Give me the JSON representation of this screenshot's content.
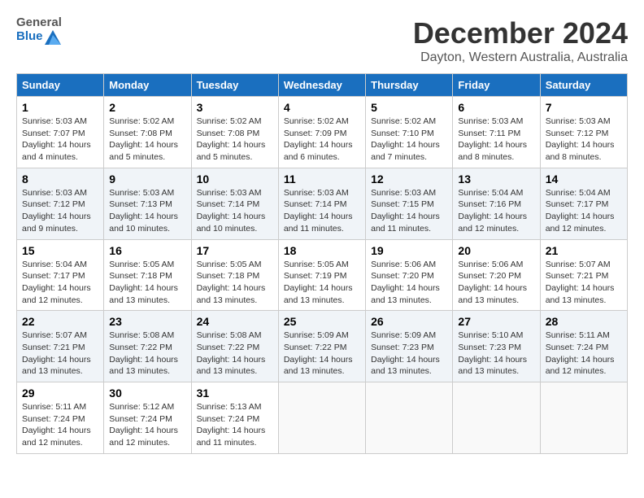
{
  "logo": {
    "general": "General",
    "blue": "Blue"
  },
  "title": "December 2024",
  "location": "Dayton, Western Australia, Australia",
  "headers": [
    "Sunday",
    "Monday",
    "Tuesday",
    "Wednesday",
    "Thursday",
    "Friday",
    "Saturday"
  ],
  "weeks": [
    [
      {
        "day": "1",
        "sunrise": "5:03 AM",
        "sunset": "7:07 PM",
        "daylight": "14 hours and 4 minutes."
      },
      {
        "day": "2",
        "sunrise": "5:02 AM",
        "sunset": "7:08 PM",
        "daylight": "14 hours and 5 minutes."
      },
      {
        "day": "3",
        "sunrise": "5:02 AM",
        "sunset": "7:08 PM",
        "daylight": "14 hours and 5 minutes."
      },
      {
        "day": "4",
        "sunrise": "5:02 AM",
        "sunset": "7:09 PM",
        "daylight": "14 hours and 6 minutes."
      },
      {
        "day": "5",
        "sunrise": "5:02 AM",
        "sunset": "7:10 PM",
        "daylight": "14 hours and 7 minutes."
      },
      {
        "day": "6",
        "sunrise": "5:03 AM",
        "sunset": "7:11 PM",
        "daylight": "14 hours and 8 minutes."
      },
      {
        "day": "7",
        "sunrise": "5:03 AM",
        "sunset": "7:12 PM",
        "daylight": "14 hours and 8 minutes."
      }
    ],
    [
      {
        "day": "8",
        "sunrise": "5:03 AM",
        "sunset": "7:12 PM",
        "daylight": "14 hours and 9 minutes."
      },
      {
        "day": "9",
        "sunrise": "5:03 AM",
        "sunset": "7:13 PM",
        "daylight": "14 hours and 10 minutes."
      },
      {
        "day": "10",
        "sunrise": "5:03 AM",
        "sunset": "7:14 PM",
        "daylight": "14 hours and 10 minutes."
      },
      {
        "day": "11",
        "sunrise": "5:03 AM",
        "sunset": "7:14 PM",
        "daylight": "14 hours and 11 minutes."
      },
      {
        "day": "12",
        "sunrise": "5:03 AM",
        "sunset": "7:15 PM",
        "daylight": "14 hours and 11 minutes."
      },
      {
        "day": "13",
        "sunrise": "5:04 AM",
        "sunset": "7:16 PM",
        "daylight": "14 hours and 12 minutes."
      },
      {
        "day": "14",
        "sunrise": "5:04 AM",
        "sunset": "7:17 PM",
        "daylight": "14 hours and 12 minutes."
      }
    ],
    [
      {
        "day": "15",
        "sunrise": "5:04 AM",
        "sunset": "7:17 PM",
        "daylight": "14 hours and 12 minutes."
      },
      {
        "day": "16",
        "sunrise": "5:05 AM",
        "sunset": "7:18 PM",
        "daylight": "14 hours and 13 minutes."
      },
      {
        "day": "17",
        "sunrise": "5:05 AM",
        "sunset": "7:18 PM",
        "daylight": "14 hours and 13 minutes."
      },
      {
        "day": "18",
        "sunrise": "5:05 AM",
        "sunset": "7:19 PM",
        "daylight": "14 hours and 13 minutes."
      },
      {
        "day": "19",
        "sunrise": "5:06 AM",
        "sunset": "7:20 PM",
        "daylight": "14 hours and 13 minutes."
      },
      {
        "day": "20",
        "sunrise": "5:06 AM",
        "sunset": "7:20 PM",
        "daylight": "14 hours and 13 minutes."
      },
      {
        "day": "21",
        "sunrise": "5:07 AM",
        "sunset": "7:21 PM",
        "daylight": "14 hours and 13 minutes."
      }
    ],
    [
      {
        "day": "22",
        "sunrise": "5:07 AM",
        "sunset": "7:21 PM",
        "daylight": "14 hours and 13 minutes."
      },
      {
        "day": "23",
        "sunrise": "5:08 AM",
        "sunset": "7:22 PM",
        "daylight": "14 hours and 13 minutes."
      },
      {
        "day": "24",
        "sunrise": "5:08 AM",
        "sunset": "7:22 PM",
        "daylight": "14 hours and 13 minutes."
      },
      {
        "day": "25",
        "sunrise": "5:09 AM",
        "sunset": "7:22 PM",
        "daylight": "14 hours and 13 minutes."
      },
      {
        "day": "26",
        "sunrise": "5:09 AM",
        "sunset": "7:23 PM",
        "daylight": "14 hours and 13 minutes."
      },
      {
        "day": "27",
        "sunrise": "5:10 AM",
        "sunset": "7:23 PM",
        "daylight": "14 hours and 13 minutes."
      },
      {
        "day": "28",
        "sunrise": "5:11 AM",
        "sunset": "7:24 PM",
        "daylight": "14 hours and 12 minutes."
      }
    ],
    [
      {
        "day": "29",
        "sunrise": "5:11 AM",
        "sunset": "7:24 PM",
        "daylight": "14 hours and 12 minutes."
      },
      {
        "day": "30",
        "sunrise": "5:12 AM",
        "sunset": "7:24 PM",
        "daylight": "14 hours and 12 minutes."
      },
      {
        "day": "31",
        "sunrise": "5:13 AM",
        "sunset": "7:24 PM",
        "daylight": "14 hours and 11 minutes."
      },
      null,
      null,
      null,
      null
    ]
  ]
}
